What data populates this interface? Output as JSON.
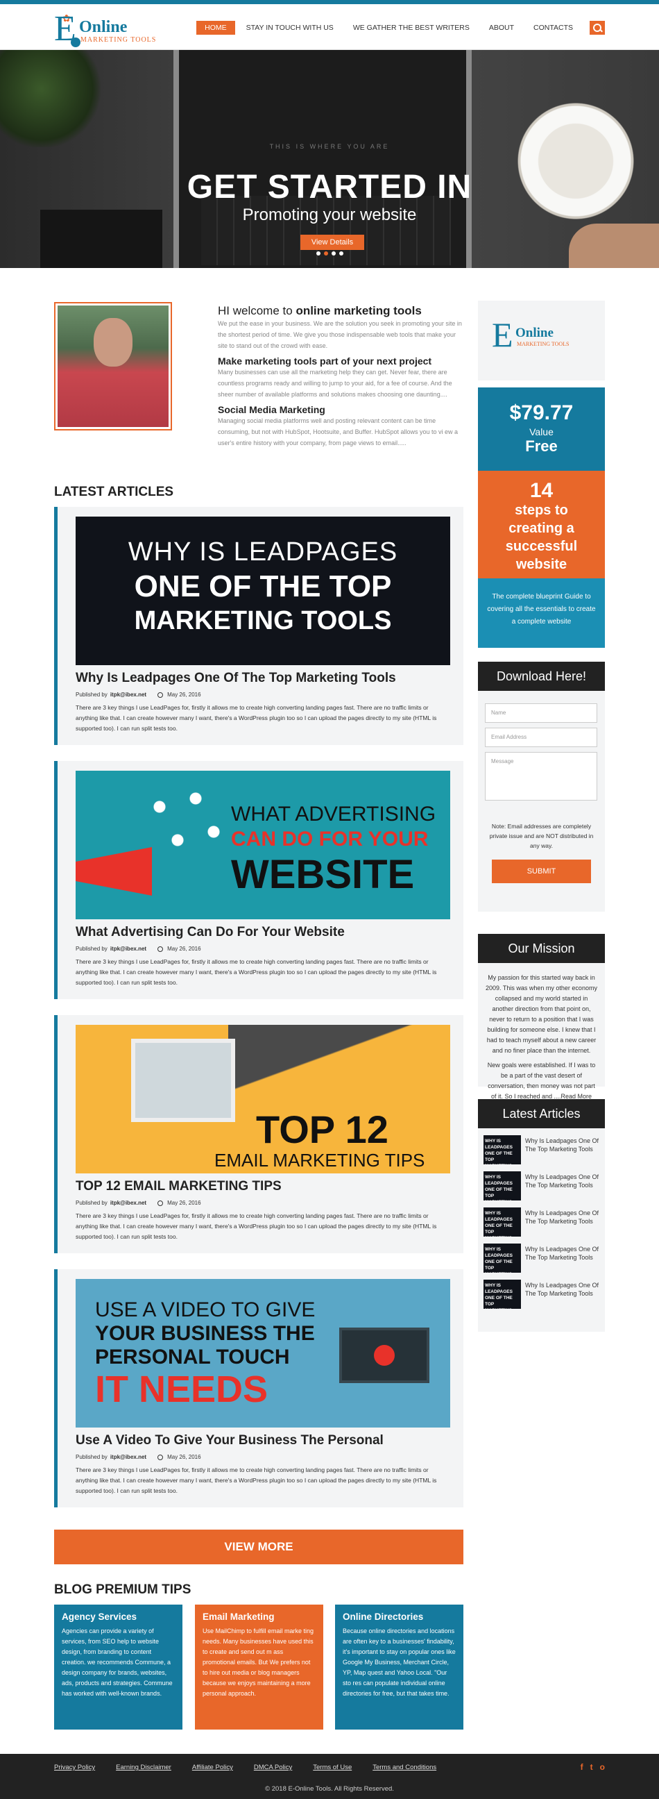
{
  "brand": {
    "logo_e": "E",
    "logo_title": "Online",
    "logo_sub": "MARKETING TOOLS",
    "colors": {
      "accent": "#e8672a",
      "brand": "#157a9e"
    }
  },
  "nav": {
    "items": [
      {
        "label": "HOME",
        "active": true
      },
      {
        "label": "STAY IN TOUCH WITH US"
      },
      {
        "label": "WE GATHER THE BEST WRITERS"
      },
      {
        "label": "ABOUT"
      },
      {
        "label": "CONTACTS"
      }
    ],
    "search_icon": "search-icon"
  },
  "hero": {
    "small": "THIS IS WHERE YOU ARE",
    "title": "GET STARTED IN",
    "subtitle": "Promoting your website",
    "button": "View Details",
    "slides": 4,
    "active_slide": 1
  },
  "intro": {
    "heading_prefix": "HI welcome to ",
    "heading_bold": "online marketing tools",
    "p1": "We put the ease in your business. We are the solution you seek in promoting your site in the shortest period of time. We give you those indispensable web tools that make your site to stand out of the crowd with ease.",
    "h2": "Make marketing tools part of your next project",
    "p2": "Many businesses can use all the marketing help they can get. Never fear, there are countless programs ready and willing to jump to your aid, for a fee of course. And the sheer number of available platforms and solutions makes choosing one daunting....",
    "h3": "Social Media Marketing",
    "p3": "Managing social media platforms well and posting relevant content can be time consuming, but not with HubSpot, Hootsuite, and Buffer. HubSpot allows you to vi ew a user's entire history with your company, from page views to email....."
  },
  "latest_articles": {
    "title": "LATEST ARTICLES",
    "cards": [
      {
        "banner": [
          "WHY IS LEADPAGES",
          "ONE OF THE TOP",
          "MARKETING TOOLS"
        ],
        "title": "Why Is Leadpages One Of The Top Marketing Tools",
        "published_by": "Published by",
        "author": "itpk@ibex.net",
        "date": "May 26, 2016",
        "excerpt": "There are 3 key things I use LeadPages for, firstly it allows me to create high converting landing pages fast. There are no traffic limits or anything like that. I can create however many I want, there's a WordPress plugin too so I can upload the pages directly to my site (HTML is supported too). I can run split tests too."
      },
      {
        "banner": [
          "WHAT ADVERTISING",
          "CAN DO FOR YOUR",
          "WEBSITE"
        ],
        "title": "What Advertising Can Do For Your Website",
        "published_by": "Published by",
        "author": "itpk@ibex.net",
        "date": "May 26, 2016",
        "excerpt": "There are 3 key things I use LeadPages for, firstly it allows me to create high converting landing pages fast. There are no traffic limits or anything like that. I can create however many I want, there's a WordPress plugin too so I can upload the pages directly to my site (HTML is supported too). I can run split tests too."
      },
      {
        "banner": [
          "TOP 12",
          "EMAIL MARKETING TIPS"
        ],
        "title": "TOP 12 EMAIL MARKETING TIPS",
        "published_by": "Published by",
        "author": "itpk@ibex.net",
        "date": "May 26, 2016",
        "excerpt": "There are 3 key things I use LeadPages for, firstly it allows me to create high converting landing pages fast. There are no traffic limits or anything like that. I can create however many I want, there's a WordPress plugin too so I can upload the pages directly to my site (HTML is supported too). I can run split tests too."
      },
      {
        "banner": [
          "USE A VIDEO TO GIVE",
          "YOUR BUSINESS THE",
          "PERSONAL TOUCH",
          "IT NEEDS"
        ],
        "title": "Use A Video To Give Your Business The Personal",
        "published_by": "Published by",
        "author": "itpk@ibex.net",
        "date": "May 26, 2016",
        "excerpt": "There are 3 key things I use LeadPages for, firstly it allows me to create high converting landing pages fast. There are no traffic limits or anything like that. I can create however many I want, there's a WordPress plugin too so I can upload the pages directly to my site (HTML is supported too). I can run split tests too."
      }
    ],
    "view_more": "VIEW MORE"
  },
  "tips": {
    "title": "BLOG PREMIUM TIPS",
    "items": [
      {
        "title": "Agency Services",
        "text": "Agencies can provide a variety of services, from SEO help to website design, from branding to content creation. we recommends Commune, a design company for brands, websites, ads, products and strategies. Commune has worked with well-known brands."
      },
      {
        "title": "Email Marketing",
        "text": "Use MailChimp to fulfill email marke ting needs. Many businesses have used this to create and send out m ass promotional emails. But We prefers not to hire out media or blog managers because we enjoys maintaining a more personal approach."
      },
      {
        "title": "Online Directories",
        "text": "Because online directories and locations are often key to a businesses' findability, it's important to stay on popular ones like Google My Business, Merchant Circle, YP, Map quest and Yahoo Local. \"Our sto res can populate individual online directories for free, but that takes time."
      }
    ]
  },
  "sidebar": {
    "offer": {
      "price": "$79.77",
      "value": "Value",
      "free": "Free",
      "num": "14",
      "l1": "steps to",
      "l2": "creating a",
      "l3": "successful",
      "l4": "website",
      "blurb": "The complete blueprint Guide to covering all the essentials to create a complete website"
    },
    "download": {
      "title": "Download Here!",
      "name_ph": "Name",
      "email_ph": "Email Address",
      "msg_ph": "Message",
      "note": "Note: Email addresses are completely private issue and are NOT distributed in any way.",
      "submit": "SUBMIT"
    },
    "mission": {
      "title": "Our Mission",
      "p1": "My passion for this started way back in 2009. This was when my other economy collapsed and my world started in another direction from that point on, never to return to a position that I was building for someone else. I knew that I had to teach myself about a new career and no finer place than the internet.",
      "p2": "New goals were established. If I was to be a part of the vast desert of conversation, then money was not part of it. So I reached and ....Read More"
    },
    "latest": {
      "title": "Latest Articles",
      "thumb": "WHY IS LEADPAGES ONE OF THE TOP MARKETING TOOLS",
      "items": [
        "Why Is Leadpages One Of The Top Marketing Tools",
        "Why Is Leadpages One Of The Top Marketing Tools",
        "Why Is Leadpages One Of The Top Marketing Tools",
        "Why Is Leadpages One Of The Top Marketing Tools",
        "Why Is Leadpages One Of The Top Marketing Tools"
      ]
    }
  },
  "footer": {
    "links": [
      "Privacy Policy",
      "Earning Disclaimer",
      "Affiliate Policy",
      "DMCA Policy",
      "Terms of Use",
      "Terms and Conditions"
    ],
    "social": [
      "f",
      "t",
      "o"
    ],
    "copyright": "© 2018 E-Online Tools. All Rights Reserved."
  }
}
